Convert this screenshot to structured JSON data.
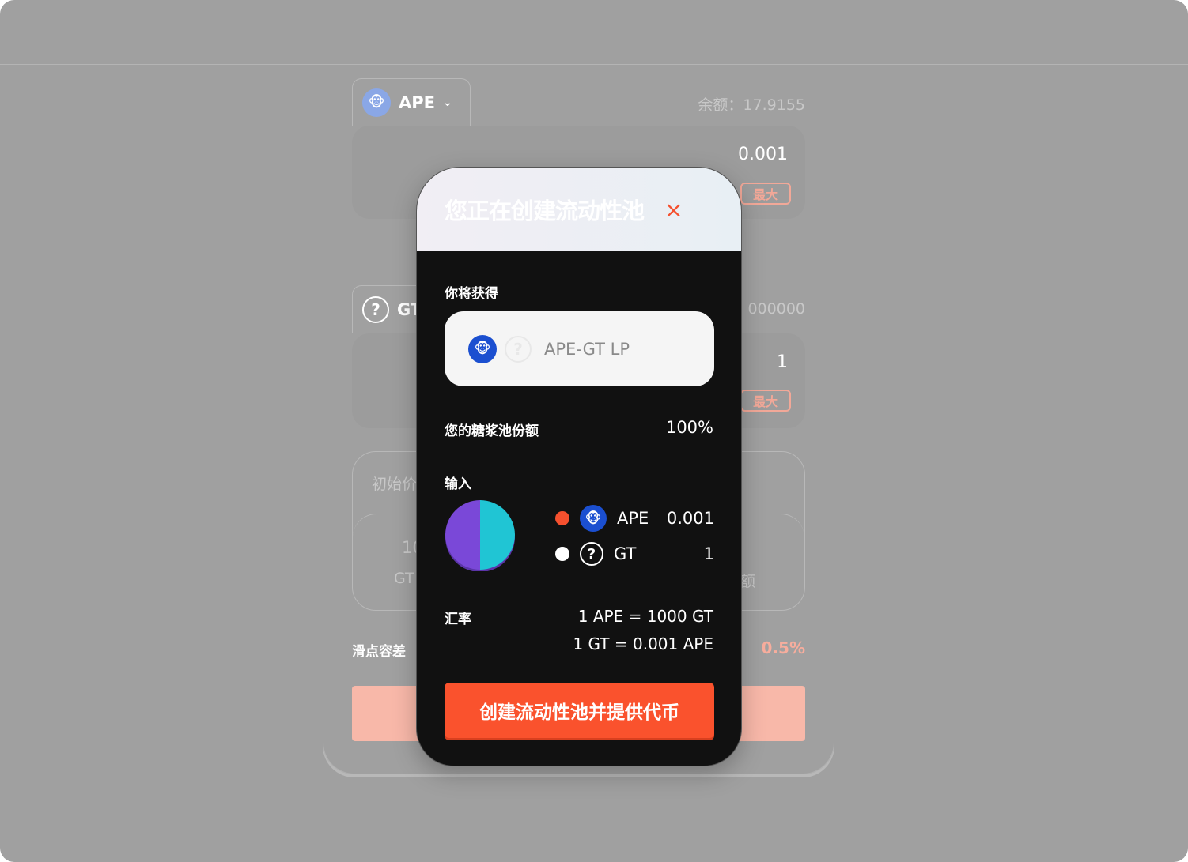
{
  "background": {
    "token_a": {
      "symbol": "APE",
      "balance": "余额：17.9155",
      "amount": "0.001",
      "max_label": "最大"
    },
    "token_b": {
      "symbol": "GT",
      "balance_partial": "000000",
      "amount": "1",
      "max_label": "最大"
    },
    "price_section": {
      "label_partial": "初始价",
      "value_partial": "10",
      "unit_partial": "GT",
      "right_partial": "额"
    },
    "slippage": {
      "label": "滑点容差",
      "value": "0.5%"
    }
  },
  "modal": {
    "title": "您正在创建流动性池",
    "close_icon": "×",
    "receive_label": "你将获得",
    "lp_token": "APE-GT LP",
    "share_label": "您的糖浆池份额",
    "share_value": "100%",
    "input_label": "输入",
    "inputs": [
      {
        "symbol": "APE",
        "amount": "0.001",
        "color": "#f5502e"
      },
      {
        "symbol": "GT",
        "amount": "1",
        "color": "#ffffff"
      }
    ],
    "pie": {
      "values": [
        50,
        50
      ],
      "colors": [
        "#7a48d8",
        "#20c5d4"
      ]
    },
    "rate_label": "汇率",
    "rates": [
      "1 APE = 1000 GT",
      "1 GT = 0.001 APE"
    ],
    "confirm_label": "创建流动性池并提供代币"
  }
}
